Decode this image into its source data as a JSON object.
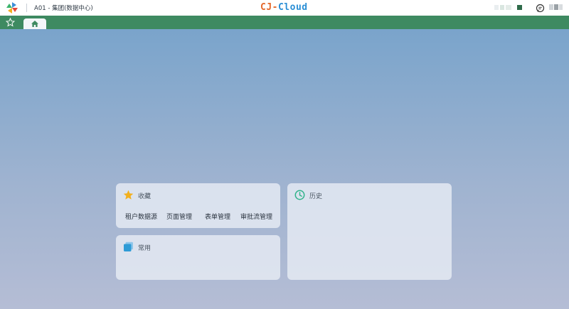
{
  "header": {
    "org_name": "A01 - 集团(数据中心)",
    "brand_part1": "CJ-",
    "brand_part2": "Cloud",
    "brand_colors": {
      "orange": "#e4682b",
      "blue": "#2a8fd6"
    },
    "logo_icon": "pinwheel-logo-icon",
    "chat_icon": "chat-bubble-icon"
  },
  "tabbar": {
    "background": "#3e8a61",
    "favorites_icon": "star-outline-icon",
    "home_tab_icon": "home-icon"
  },
  "panels": {
    "favorites": {
      "title": "收藏",
      "icon": "star-icon",
      "icon_color": "#f2b01e",
      "items": [
        "租户数据源",
        "页面管理",
        "表单管理",
        "审批流管理"
      ]
    },
    "common": {
      "title": "常用",
      "icon": "layers-icon",
      "icon_color": "#2e9bd6"
    },
    "history": {
      "title": "历史",
      "icon": "clock-icon",
      "icon_color": "#2fb38a"
    }
  }
}
